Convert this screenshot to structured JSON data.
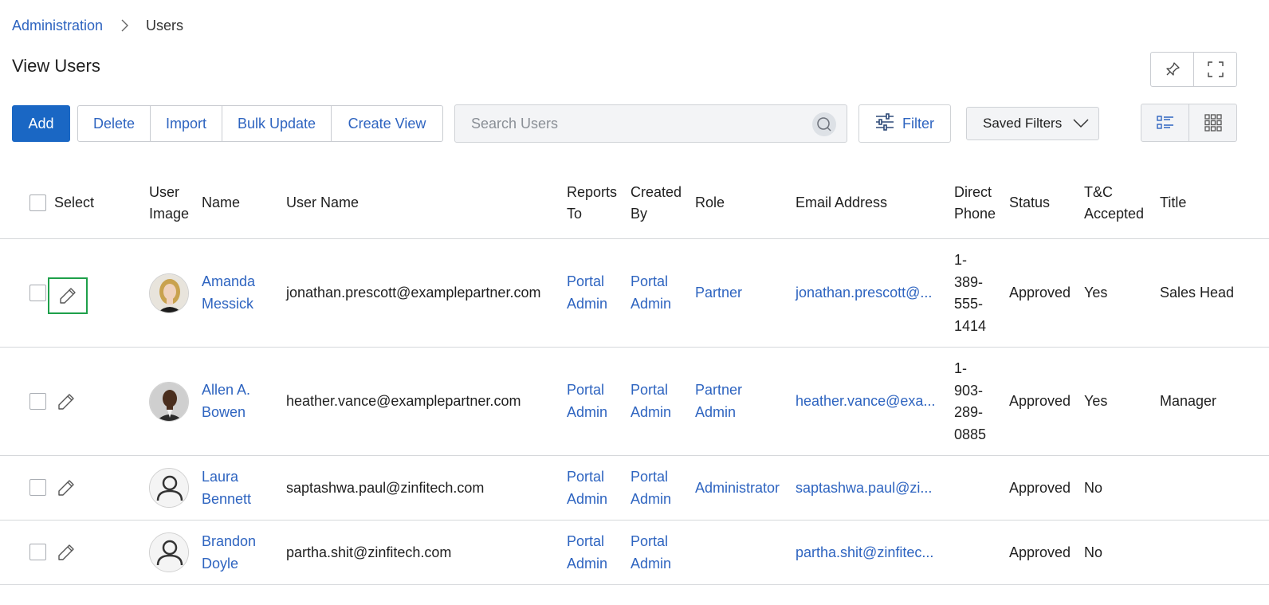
{
  "breadcrumb": {
    "parent": "Administration",
    "current": "Users"
  },
  "page": {
    "title": "View Users"
  },
  "toolbar": {
    "add_label": "Add",
    "group_buttons": [
      "Delete",
      "Import",
      "Bulk Update",
      "Create View"
    ],
    "search_placeholder": "Search Users",
    "filter_label": "Filter",
    "saved_filters_label": "Saved Filters"
  },
  "icons": {
    "pin": "pin-icon",
    "fullscreen": "fullscreen-icon",
    "search": "search-icon",
    "filter": "sliders-icon",
    "chevron": "chevron-down-icon",
    "list_view": "list-view-icon",
    "grid_view": "grid-view-icon",
    "edit": "pencil-icon"
  },
  "colors": {
    "primary": "#1a67c4",
    "link": "#2e64c0",
    "focus_outline": "#1ea04a"
  },
  "table": {
    "headers": {
      "select": "Select",
      "user_image_1": "User",
      "user_image_2": "Image",
      "name": "Name",
      "user_name": "User Name",
      "reports_to_1": "Reports",
      "reports_to_2": "To",
      "created_by_1": "Created",
      "created_by_2": "By",
      "role": "Role",
      "email": "Email Address",
      "direct_phone_1": "Direct",
      "direct_phone_2": "Phone",
      "status": "Status",
      "tc_1": "T&C",
      "tc_2": "Accepted",
      "title": "Title"
    },
    "rows": [
      {
        "name_1": "Amanda",
        "name_2": "Messick",
        "user_name": "jonathan.prescott@examplepartner.com",
        "reports_to_1": "Portal",
        "reports_to_2": "Admin",
        "created_by_1": "Portal",
        "created_by_2": "Admin",
        "role_1": "Partner",
        "role_2": "",
        "email": "jonathan.prescott@...",
        "phone": [
          "1-",
          "389-",
          "555-",
          "1414"
        ],
        "status": "Approved",
        "tc": "Yes",
        "title": "Sales Head",
        "avatar": "photo-woman"
      },
      {
        "name_1": "Allen A.",
        "name_2": "Bowen",
        "user_name": "heather.vance@examplepartner.com",
        "reports_to_1": "Portal",
        "reports_to_2": "Admin",
        "created_by_1": "Portal",
        "created_by_2": "Admin",
        "role_1": "Partner",
        "role_2": "Admin",
        "email": "heather.vance@exa...",
        "phone": [
          "1-",
          "903-",
          "289-",
          "0885"
        ],
        "status": "Approved",
        "tc": "Yes",
        "title": "Manager",
        "avatar": "photo-man"
      },
      {
        "name_1": "Laura",
        "name_2": "Bennett",
        "user_name": "saptashwa.paul@zinfitech.com",
        "reports_to_1": "Portal",
        "reports_to_2": "Admin",
        "created_by_1": "Portal",
        "created_by_2": "Admin",
        "role_1": "Administrator",
        "role_2": "",
        "email": "saptashwa.paul@zi...",
        "phone": [],
        "status": "Approved",
        "tc": "No",
        "title": "",
        "avatar": "default-user-icon"
      },
      {
        "name_1": "Brandon",
        "name_2": "Doyle",
        "user_name": "partha.shit@zinfitech.com",
        "reports_to_1": "Portal",
        "reports_to_2": "Admin",
        "created_by_1": "Portal",
        "created_by_2": "Admin",
        "role_1": "",
        "role_2": "",
        "email": "partha.shit@zinfitec...",
        "phone": [],
        "status": "Approved",
        "tc": "No",
        "title": "",
        "avatar": "default-user-icon"
      }
    ]
  }
}
